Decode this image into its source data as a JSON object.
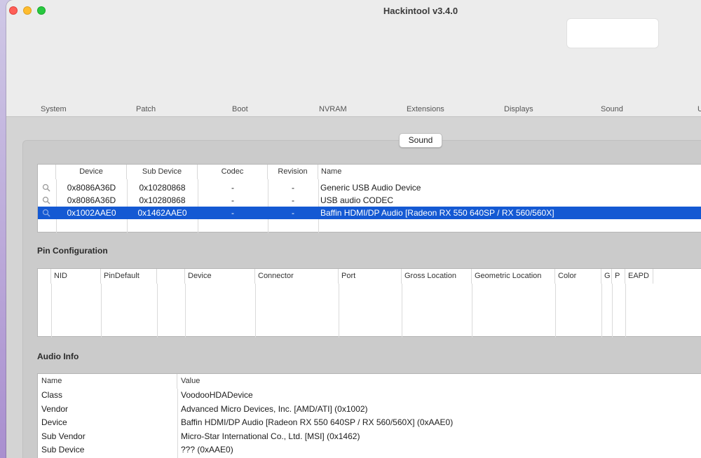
{
  "window": {
    "title": "Hackintool v3.4.0"
  },
  "toolbar": {
    "tabs": [
      "System",
      "Patch",
      "Boot",
      "NVRAM",
      "Extensions",
      "Displays",
      "Sound",
      "U"
    ]
  },
  "segment": {
    "label": "Sound"
  },
  "devices": {
    "headers": [
      "Device",
      "Sub Device",
      "Codec",
      "Revision",
      "Name"
    ],
    "rows": [
      {
        "device": "0x8086A36D",
        "sub_device": "0x10280868",
        "codec": "-",
        "revision": "-",
        "name": "Generic USB Audio Device",
        "selected": false
      },
      {
        "device": "0x8086A36D",
        "sub_device": "0x10280868",
        "codec": "-",
        "revision": "-",
        "name": "USB audio CODEC",
        "selected": false
      },
      {
        "device": "0x1002AAE0",
        "sub_device": "0x1462AAE0",
        "codec": "-",
        "revision": "-",
        "name": "Baffin HDMI/DP Audio [Radeon RX 550 640SP / RX 560/560X]",
        "selected": true
      }
    ]
  },
  "pin_config": {
    "title": "Pin Configuration",
    "headers": [
      "NID",
      "PinDefault",
      "",
      "Device",
      "Connector",
      "Port",
      "Gross Location",
      "Geometric Location",
      "Color",
      "G",
      "P",
      "EAPD"
    ]
  },
  "audio_info": {
    "title": "Audio Info",
    "headers": [
      "Name",
      "Value"
    ],
    "rows": [
      {
        "name": "Class",
        "value": "VoodooHDADevice"
      },
      {
        "name": "Vendor",
        "value": "Advanced Micro Devices, Inc. [AMD/ATI] (0x1002)"
      },
      {
        "name": "Device",
        "value": "Baffin HDMI/DP Audio [Radeon RX 550 640SP / RX 560/560X] (0xAAE0)"
      },
      {
        "name": "Sub Vendor",
        "value": "Micro-Star International Co., Ltd. [MSI] (0x1462)"
      },
      {
        "name": "Sub Device",
        "value": "??? (0xAAE0)"
      }
    ]
  },
  "colors": {
    "selection": "#1459d3",
    "close": "#ff5f57",
    "minimize": "#febc2e",
    "maximize": "#28c840"
  }
}
